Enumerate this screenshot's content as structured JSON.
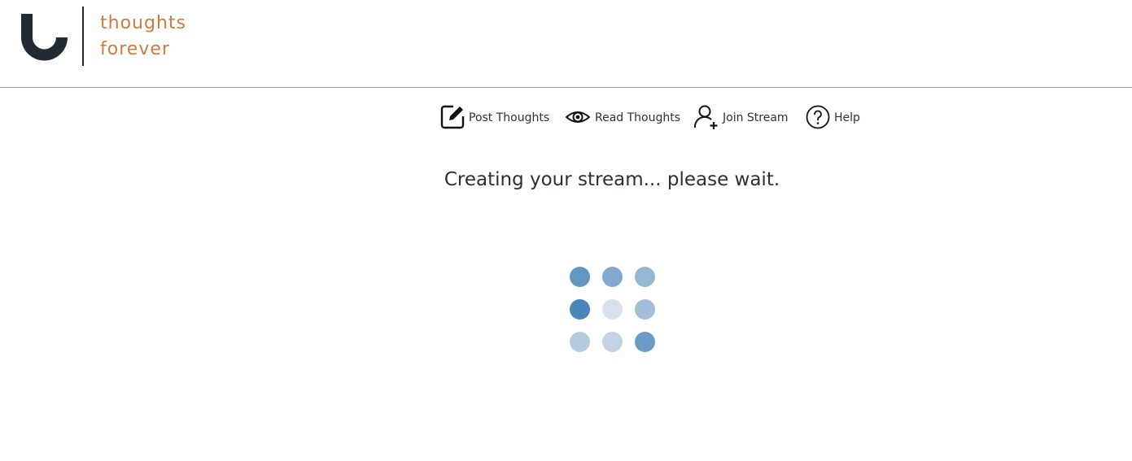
{
  "brand": {
    "line1": "thoughts",
    "line2": "forever",
    "text_color": "#d17a3e",
    "mark_color": "#222b33"
  },
  "nav": {
    "items": [
      {
        "label": "Post Thoughts",
        "icon": "edit-icon"
      },
      {
        "label": "Read Thoughts",
        "icon": "eye-icon"
      },
      {
        "label": "Join Stream",
        "icon": "add-user-icon"
      },
      {
        "label": "Help",
        "icon": "help-icon"
      }
    ]
  },
  "status_text": "Creating your stream... please wait.",
  "spinner": {
    "icon": "loading-dots-spinner",
    "dot_colors": [
      "#6596c2",
      "#85a9cd",
      "#97b6d4",
      "#4a86b9",
      "#d5e2ee",
      "#a3bed8",
      "#b7cbe0",
      "#c2d3e5",
      "#6b9bc6"
    ]
  }
}
